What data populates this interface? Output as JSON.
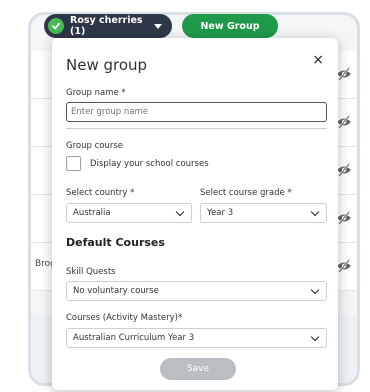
{
  "class_selector": {
    "label": "Rosy cherries (1)"
  },
  "new_group_button": {
    "label": "New Group"
  },
  "background_rows": [
    {
      "text": ""
    },
    {
      "text": ""
    },
    {
      "text": ""
    },
    {
      "text": ""
    },
    {
      "text": "Brogli"
    }
  ],
  "modal": {
    "title": "New group",
    "close_label": "×",
    "group_name": {
      "label": "Group name *",
      "placeholder": "Enter group name",
      "value": ""
    },
    "group_course": {
      "label": "Group course",
      "checkbox_label": "Display your school courses",
      "checked": false
    },
    "country": {
      "label": "Select country *",
      "value": "Australia"
    },
    "grade": {
      "label": "Select course grade *",
      "value": "Year 3"
    },
    "default_courses_heading": "Default Courses",
    "skill_quests": {
      "label": "Skill Quests",
      "value": "No voluntary course"
    },
    "activity_mastery": {
      "label": "Courses (Activity Mastery)*",
      "value": "Australian Curriculum Year 3"
    },
    "save_label": "Save"
  },
  "colors": {
    "class_pill_bg": "#2d3748",
    "check_green": "#47b955",
    "new_group_green": "#1f9a4a",
    "save_disabled": "#b9bec3"
  }
}
